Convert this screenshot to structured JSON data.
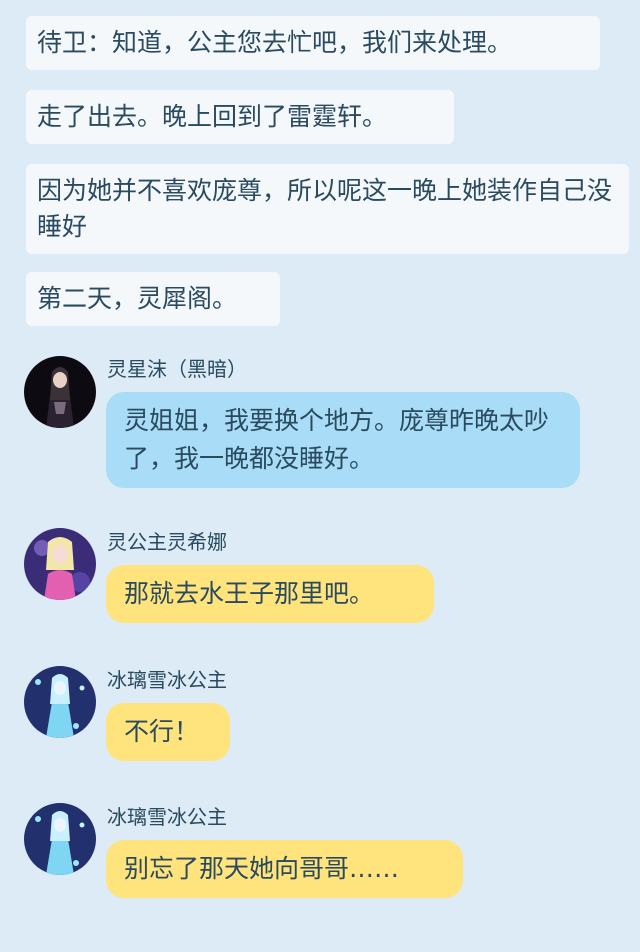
{
  "narration": [
    "待卫：知道，公主您去忙吧，我们来处理。",
    "走了出去。晚上回到了雷霆轩。",
    "因为她并不喜欢庞尊，所以呢这一晚上她装作自己没睡好",
    "第二天，灵犀阁。"
  ],
  "messages": [
    {
      "name": "灵星沫（黑暗）",
      "text": "灵姐姐，我要换个地方。庞尊昨晚太吵了，我一晚都没睡好。",
      "bubble_color": "#a9dcf6"
    },
    {
      "name": "灵公主灵希娜",
      "text": "那就去水王子那里吧。",
      "bubble_color": "#ffe37c"
    },
    {
      "name": "冰璃雪冰公主",
      "text": "不行！",
      "bubble_color": "#ffe37c"
    },
    {
      "name": "冰璃雪冰公主",
      "text": "别忘了那天她向哥哥……",
      "bubble_color": "#ffe37c"
    }
  ],
  "avatars": [
    "dark-princess-avatar",
    "pink-princess-avatar",
    "ice-princess-avatar",
    "ice-princess-avatar"
  ]
}
